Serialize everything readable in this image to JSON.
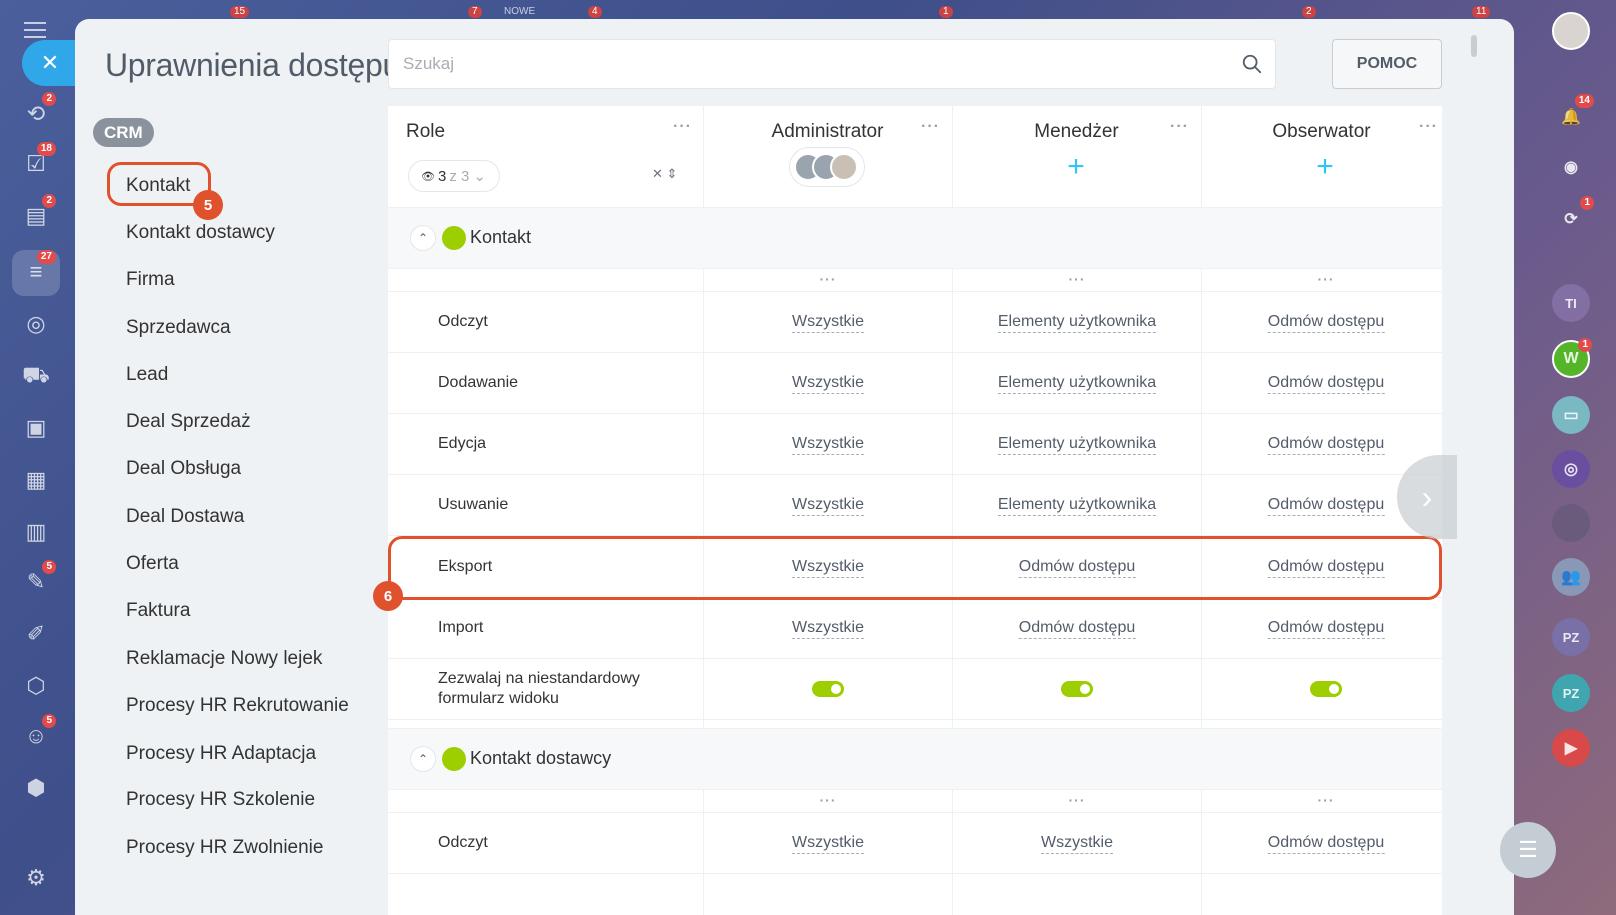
{
  "top_badges": [
    "15",
    "7",
    "NOWE",
    "4",
    "1",
    "2",
    "11"
  ],
  "left_rail": {
    "items": [
      {
        "icon": "route-icon",
        "badge": "2"
      },
      {
        "icon": "tasks-icon",
        "badge": "18"
      },
      {
        "icon": "contact-card-icon",
        "badge": "2"
      },
      {
        "icon": "crm-funnel-icon",
        "badge": "27"
      },
      {
        "icon": "target-icon",
        "badge": ""
      },
      {
        "icon": "cart-icon",
        "badge": ""
      },
      {
        "icon": "inbox-icon",
        "badge": ""
      },
      {
        "icon": "calendar-icon",
        "badge": ""
      },
      {
        "icon": "bar-chart-icon",
        "badge": ""
      },
      {
        "icon": "document-sign-icon",
        "badge": "5"
      },
      {
        "icon": "pen-icon",
        "badge": ""
      },
      {
        "icon": "hexagon-icon",
        "badge": ""
      },
      {
        "icon": "robot-icon",
        "badge": "5"
      },
      {
        "icon": "box-icon",
        "badge": ""
      },
      {
        "icon": "settings-icon",
        "badge": ""
      }
    ]
  },
  "right_rail": {
    "items": [
      {
        "icon": "bell-icon",
        "badge": "14",
        "label": ""
      },
      {
        "icon": "spiral-icon",
        "badge": "",
        "label": ""
      },
      {
        "icon": "chat-refresh-icon",
        "badge": "1",
        "label": ""
      },
      {
        "icon": "avatar-icon",
        "badge": "",
        "label": "TI"
      },
      {
        "icon": "avatar-icon",
        "badge": "1",
        "label": "W"
      },
      {
        "icon": "group-chat-icon",
        "badge": "",
        "label": ""
      },
      {
        "icon": "open-channel-icon",
        "badge": "",
        "label": ""
      },
      {
        "icon": "image-avatar-icon",
        "badge": "",
        "label": ""
      },
      {
        "icon": "people-icon",
        "badge": "",
        "label": ""
      },
      {
        "icon": "avatar-icon",
        "badge": "",
        "label": "PZ"
      },
      {
        "icon": "avatar-icon",
        "badge": "",
        "label": "PZ"
      },
      {
        "icon": "video-call-icon",
        "badge": "",
        "label": ""
      }
    ]
  },
  "page": {
    "title": "Uprawnienia dostępu",
    "search_placeholder": "Szukaj",
    "help_label": "POMOC"
  },
  "nav": {
    "group_label": "CRM",
    "items": [
      "Kontakt",
      "Kontakt dostawcy",
      "Firma",
      "Sprzedawca",
      "Lead",
      "Deal Sprzedaż",
      "Deal Obsługa",
      "Deal Dostawa",
      "Oferta",
      "Faktura",
      "Reklamacje Nowy lejek",
      "Procesy HR Rekrutowanie",
      "Procesy HR Adaptacja",
      "Procesy HR Szkolenie",
      "Procesy HR Zwolnienie"
    ]
  },
  "markers": {
    "nav_step": "5",
    "row_step": "6"
  },
  "table": {
    "role_header": "Role",
    "filter": {
      "shown": "3",
      "of": "z 3"
    },
    "roles": [
      "Administrator",
      "Menedżer",
      "Obserwator"
    ],
    "sections": [
      {
        "title": "Kontakt",
        "rows": [
          {
            "label": "Odczyt",
            "values": [
              "Wszystkie",
              "Elementy użytkownika",
              "Odmów dostępu"
            ]
          },
          {
            "label": "Dodawanie",
            "values": [
              "Wszystkie",
              "Elementy użytkownika",
              "Odmów dostępu"
            ]
          },
          {
            "label": "Edycja",
            "values": [
              "Wszystkie",
              "Elementy użytkownika",
              "Odmów dostępu"
            ]
          },
          {
            "label": "Usuwanie",
            "values": [
              "Wszystkie",
              "Elementy użytkownika",
              "Odmów dostępu"
            ]
          },
          {
            "label": "Eksport",
            "values": [
              "Wszystkie",
              "Odmów dostępu",
              "Odmów dostępu"
            ]
          },
          {
            "label": "Import",
            "values": [
              "Wszystkie",
              "Odmów dostępu",
              "Odmów dostępu"
            ]
          },
          {
            "label": "Zezwalaj na niestandardowy formularz widoku",
            "toggles": [
              true,
              true,
              true
            ]
          }
        ]
      },
      {
        "title": "Kontakt dostawcy",
        "rows": [
          {
            "label": "Odczyt",
            "values": [
              "Wszystkie",
              "Wszystkie",
              "Odmów dostępu"
            ]
          }
        ]
      }
    ]
  },
  "colors": {
    "accent_blue": "#2fa7e8",
    "plus_blue": "#2fc6f6",
    "toggle_green": "#9dcf00",
    "highlight_orange": "#e0522e",
    "badge_red": "#e24b4b"
  }
}
